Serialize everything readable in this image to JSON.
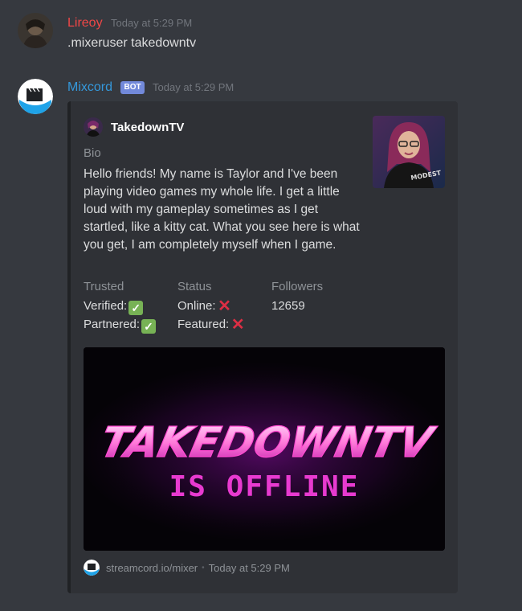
{
  "messages": [
    {
      "author": "Lireoy",
      "author_color": "#f04747",
      "timestamp": "Today at 5:29 PM",
      "content": ".mixeruser takedowntv"
    },
    {
      "author": "Mixcord",
      "author_color": "#3498db",
      "bot_tag": "BOT",
      "timestamp": "Today at 5:29 PM"
    }
  ],
  "embed": {
    "author_name": "TakedownTV",
    "bio_label": "Bio",
    "bio_text": "Hello friends! My name is Taylor and I've been playing video games my whole life. I get a little loud with my gameplay sometimes as I get startled, like a kitty cat. What you see here is what you get, I am completely myself when I game.",
    "fields": {
      "trusted": {
        "label": "Trusted",
        "verified_label": "Verified:",
        "verified_value": true,
        "partnered_label": "Partnered:",
        "partnered_value": true
      },
      "status": {
        "label": "Status",
        "online_label": "Online:",
        "online_value": false,
        "featured_label": "Featured:",
        "featured_value": false
      },
      "followers": {
        "label": "Followers",
        "value": "12659"
      }
    },
    "image": {
      "title_line": "TAKEDOWNTV",
      "subtitle_line": "IS OFFLINE"
    },
    "footer": {
      "text": "streamcord.io/mixer",
      "separator": "•",
      "timestamp": "Today at 5:29 PM"
    }
  },
  "icons": {
    "check": "white-check-mark-icon",
    "cross": "cross-mark-icon"
  }
}
